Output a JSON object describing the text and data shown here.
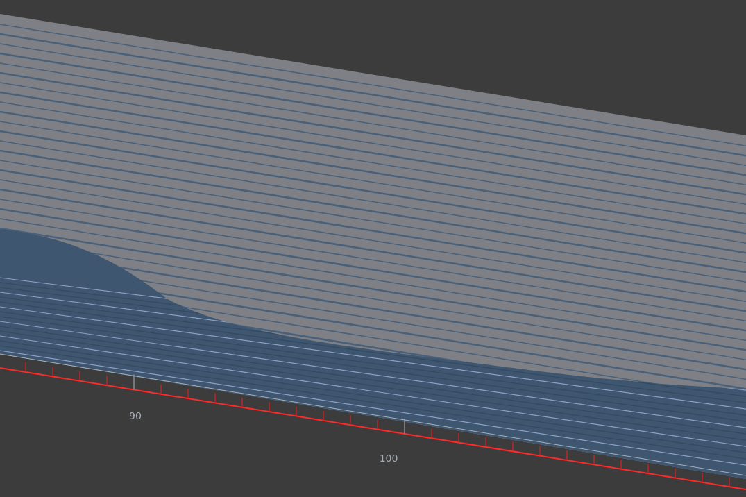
{
  "viewport": {
    "ruler": {
      "labels": [
        "90",
        "100"
      ]
    }
  }
}
